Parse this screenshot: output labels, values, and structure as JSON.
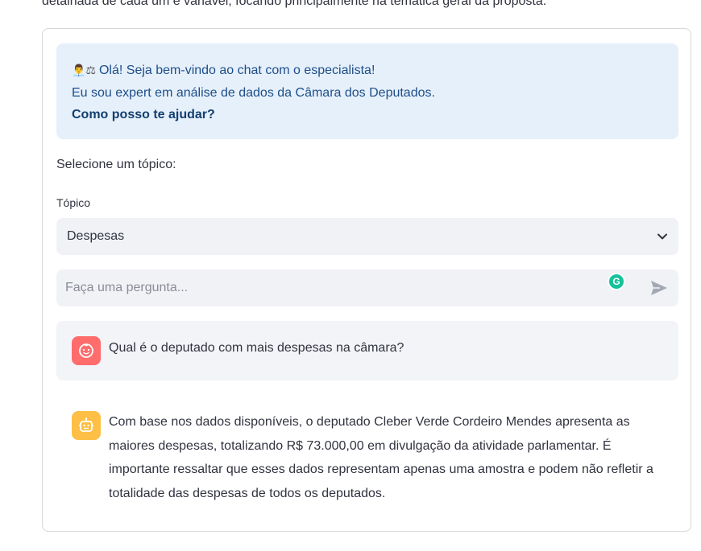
{
  "intro_text": "detalhada de cada um é variável, focando principalmente na temática geral da proposta.",
  "alert": {
    "emoji": "👨‍💼⚖",
    "line1": "Olá! Seja bem-vindo ao chat com o especialista!",
    "line2": "Eu sou expert em análise de dados da Câmara dos Deputados.",
    "line3": "Como posso te ajudar?"
  },
  "topic_prompt": "Selecione um tópico:",
  "topic_label": "Tópico",
  "topic_selected": "Despesas",
  "chat_input": {
    "placeholder": "Faça uma pergunta..."
  },
  "messages": {
    "user_text": "Qual é o deputado com mais despesas na câmara?",
    "bot_text": "Com base nos dados disponíveis, o deputado Cleber Verde Cordeiro Mendes apresenta as maiores despesas, totalizando R$ 73.000,00 em divulgação da atividade parlamentar. É importante ressaltar que esses dados representam apenas uma amostra e podem não refletir a totalidade das despesas de todos os deputados."
  },
  "colors": {
    "alert_bg": "#e6f0fb",
    "user_avatar": "#ff6c6c",
    "bot_avatar": "#fdbf45",
    "grammarly": "#15c39a"
  },
  "icons": {
    "select": "chevron-down-icon",
    "send": "send-icon",
    "user_avatar": "user-face-icon",
    "bot_avatar": "robot-icon",
    "grammarly": "grammarly-icon"
  },
  "grammarly_letter": "G"
}
